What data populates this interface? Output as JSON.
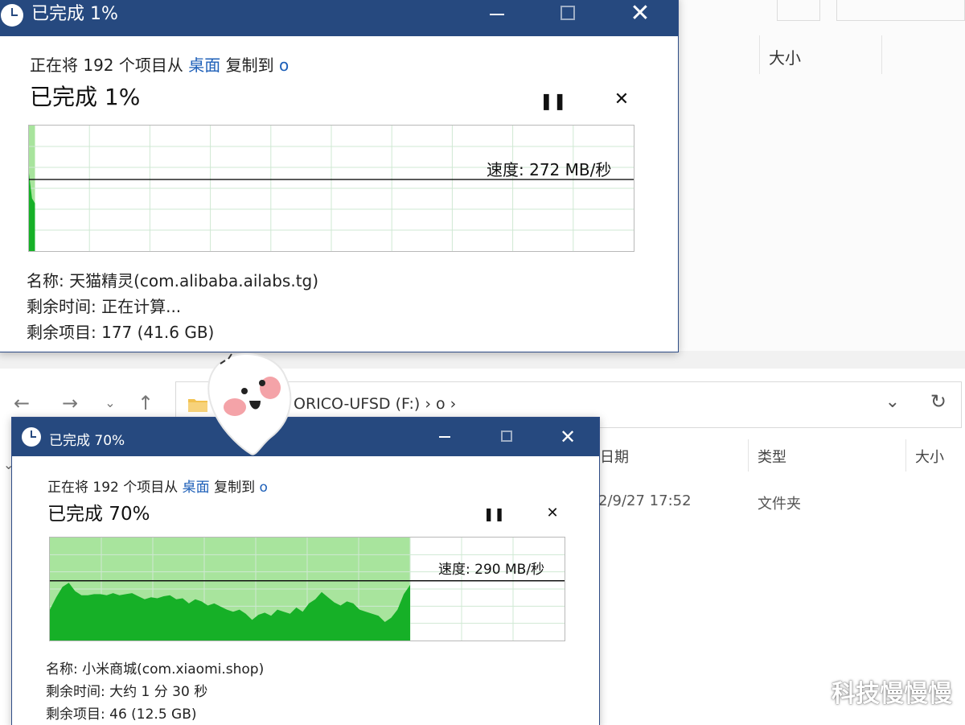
{
  "top_explorer": {
    "column_size": "大小"
  },
  "bottom_explorer": {
    "address_path": "ORICO-UFSD (F:)  ›  o  ›",
    "columns": {
      "date": "日期",
      "type": "类型",
      "size": "大小"
    },
    "row": {
      "date": "2/9/27 17:52",
      "type": "文件夹"
    }
  },
  "dialogs": [
    {
      "title": "已完成 1%",
      "line_prefix": "正在将 192 个项目从 ",
      "line_source": "桌面",
      "line_middle": " 复制到 ",
      "line_dest": "o",
      "percent_text": "已完成 1%",
      "progress": 0.01,
      "speed": "速度: 272 MB/秒",
      "name": "名称: 天猫精灵(com.alibaba.ailabs.tg)",
      "time_remaining": "剩余时间: 正在计算...",
      "items_remaining": "剩余项目: 177 (41.6 GB)",
      "speed_line_level": 0.57,
      "throughput_samples": [
        0.62,
        0.42,
        0.38
      ]
    },
    {
      "title": "已完成 70%",
      "line_prefix": "正在将 192 个项目从 ",
      "line_source": "桌面",
      "line_middle": " 复制到 ",
      "line_dest": "o",
      "percent_text": "已完成 70%",
      "progress": 0.7,
      "speed": "速度: 290 MB/秒",
      "name": "名称: 小米商城(com.xiaomi.shop)",
      "time_remaining": "剩余时间: 大约 1 分 30 秒",
      "items_remaining": "剩余项目: 46 (12.5 GB)",
      "speed_line_level": 0.58,
      "throughput_samples": [
        0.3,
        0.42,
        0.52,
        0.56,
        0.48,
        0.44,
        0.44,
        0.45,
        0.45,
        0.44,
        0.46,
        0.44,
        0.45,
        0.46,
        0.43,
        0.4,
        0.42,
        0.41,
        0.43,
        0.44,
        0.4,
        0.41,
        0.36,
        0.4,
        0.38,
        0.34,
        0.36,
        0.33,
        0.3,
        0.28,
        0.3,
        0.26,
        0.2,
        0.25,
        0.27,
        0.24,
        0.3,
        0.28,
        0.26,
        0.32,
        0.28,
        0.36,
        0.4,
        0.47,
        0.42,
        0.37,
        0.34,
        0.38,
        0.36,
        0.3,
        0.28,
        0.26,
        0.24,
        0.18,
        0.22,
        0.3,
        0.45,
        0.54
      ]
    }
  ],
  "colors": {
    "title_bar": "#26497f",
    "graph_fill_light": "#a8e49d",
    "graph_fill_dark": "#16b027",
    "graph_grid": "#cfe8d3",
    "link": "#1d5fb8"
  },
  "watermark": "科技慢慢慢"
}
